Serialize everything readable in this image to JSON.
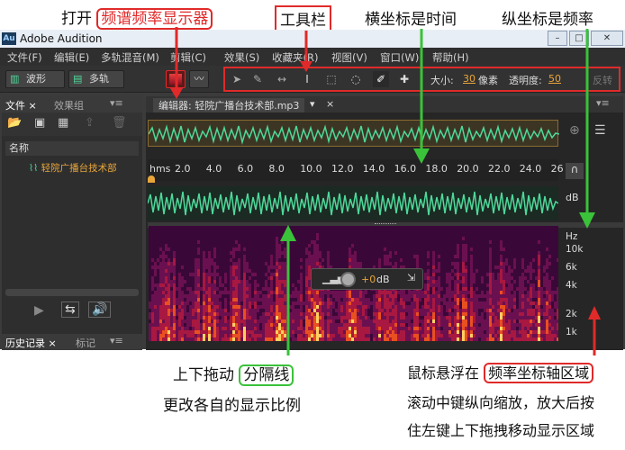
{
  "annotations": {
    "open_prefix": "打开",
    "open_highlight": "频谱频率显示器",
    "toolbar_label": "工具栏",
    "horizontal_axis": "横坐标是时间",
    "vertical_axis": "纵坐标是频率",
    "drag_prefix": "上下拖动",
    "drag_highlight": "分隔线",
    "drag_suffix": "更改各自的显示比例",
    "hover_prefix": "鼠标悬浮在",
    "hover_highlight": "频率坐标轴区域",
    "scroll_line1": "滚动中键纵向缩放，放大后按",
    "scroll_line2": "住左键上下拖拽移动显示区域"
  },
  "window": {
    "logo": "Au",
    "title": "Adobe Audition"
  },
  "menu": [
    "文件(F)",
    "编辑(E)",
    "多轨混音(M)",
    "剪辑(C)",
    "效果(S)",
    "收藏夹(R)",
    "视图(V)",
    "窗口(W)",
    "帮助(H)"
  ],
  "toolbar": {
    "waveform": "波形",
    "multitrack": "多轨",
    "size_label": "大小:",
    "size_value": "30",
    "size_unit": "像素",
    "opacity_label": "透明度:",
    "opacity_value": "50",
    "reverse": "反转"
  },
  "left_panel": {
    "tab_files": "文件",
    "tab_effects": "效果组",
    "name_header": "名称",
    "file_item": "轻院广播台技术部",
    "tab_history": "历史记录",
    "tab_markers": "标记"
  },
  "editor": {
    "tab_label": "编辑器: 轻院广播台技术部.mp3",
    "ruler_unit": "hms",
    "ticks": [
      "2.0",
      "4.0",
      "6.0",
      "8.0",
      "10.0",
      "12.0",
      "14.0",
      "16.0",
      "18.0",
      "20.0",
      "22.0",
      "24.0",
      "26"
    ],
    "db_label": "dB",
    "hz_label": "Hz",
    "freq_labels": [
      "10k",
      "6k",
      "4k",
      "2k",
      "1k"
    ],
    "hud_value": "+0",
    "hud_unit": "dB"
  },
  "colors": {
    "accent_red": "#e02a2a",
    "accent_green": "#3ac23a",
    "waveform": "#4ed99a",
    "value_orange": "#e8a53a"
  }
}
